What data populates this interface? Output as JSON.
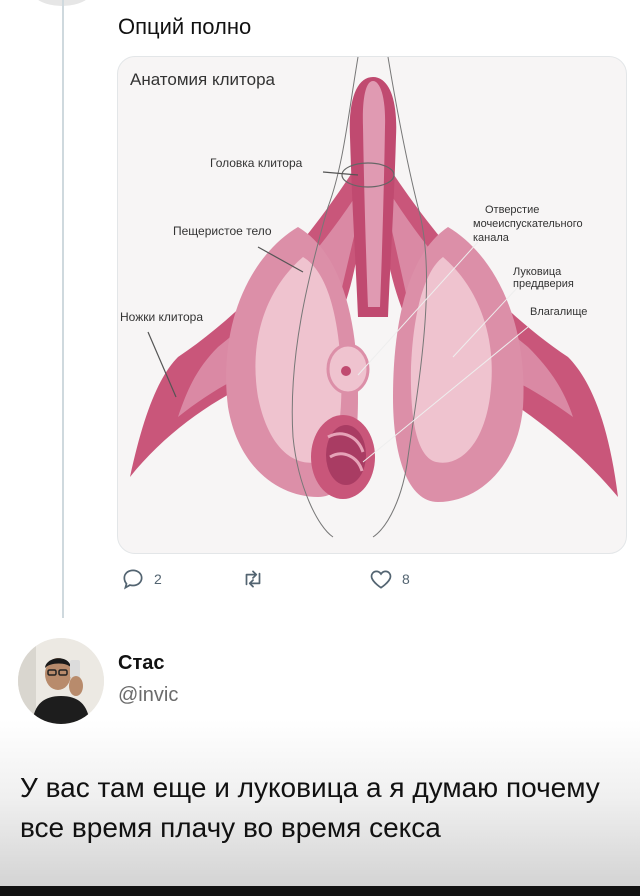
{
  "tweet": {
    "text": "Опций полно",
    "reply_count": "2",
    "like_count": "8"
  },
  "diagram": {
    "title": "Анатомия клитора",
    "labels": {
      "glans": "Головка клитора",
      "corpus": "Пещеристое тело",
      "crura": "Ножки клитора",
      "urethra_1": "Отверстие",
      "urethra_2": "мочеиспускательного",
      "urethra_3": "канала",
      "bulb_1": "Луковица",
      "bulb_2": "преддверия",
      "vagina": "Влагалище"
    }
  },
  "reply": {
    "name": "Стас",
    "handle": "@invic",
    "text": "У вас там еще и луковица а я думаю почему все время плачу во время секса"
  },
  "colors": {
    "thread_line": "#cfd9de",
    "icon_gray": "#536471",
    "pink_dark": "#c9567a",
    "pink_mid": "#dc8fa8",
    "pink_light": "#efc3cf"
  }
}
